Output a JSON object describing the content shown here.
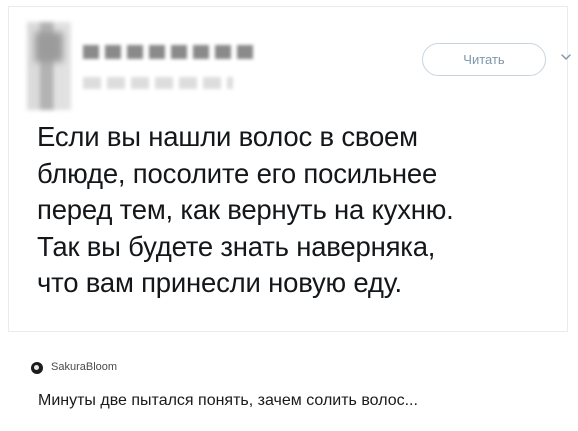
{
  "tweet": {
    "follow_button_label": "Читать",
    "text": "Если вы нашли волос в своем\nблюде, посолите его посильнее\nперед тем, как вернуть на кухню.\nТак вы будете знать наверняка,\nчто вам принесли новую еду."
  },
  "comment": {
    "author": "SakuraBloom",
    "text": "Минуты две пытался понять, зачем солить волос..."
  }
}
